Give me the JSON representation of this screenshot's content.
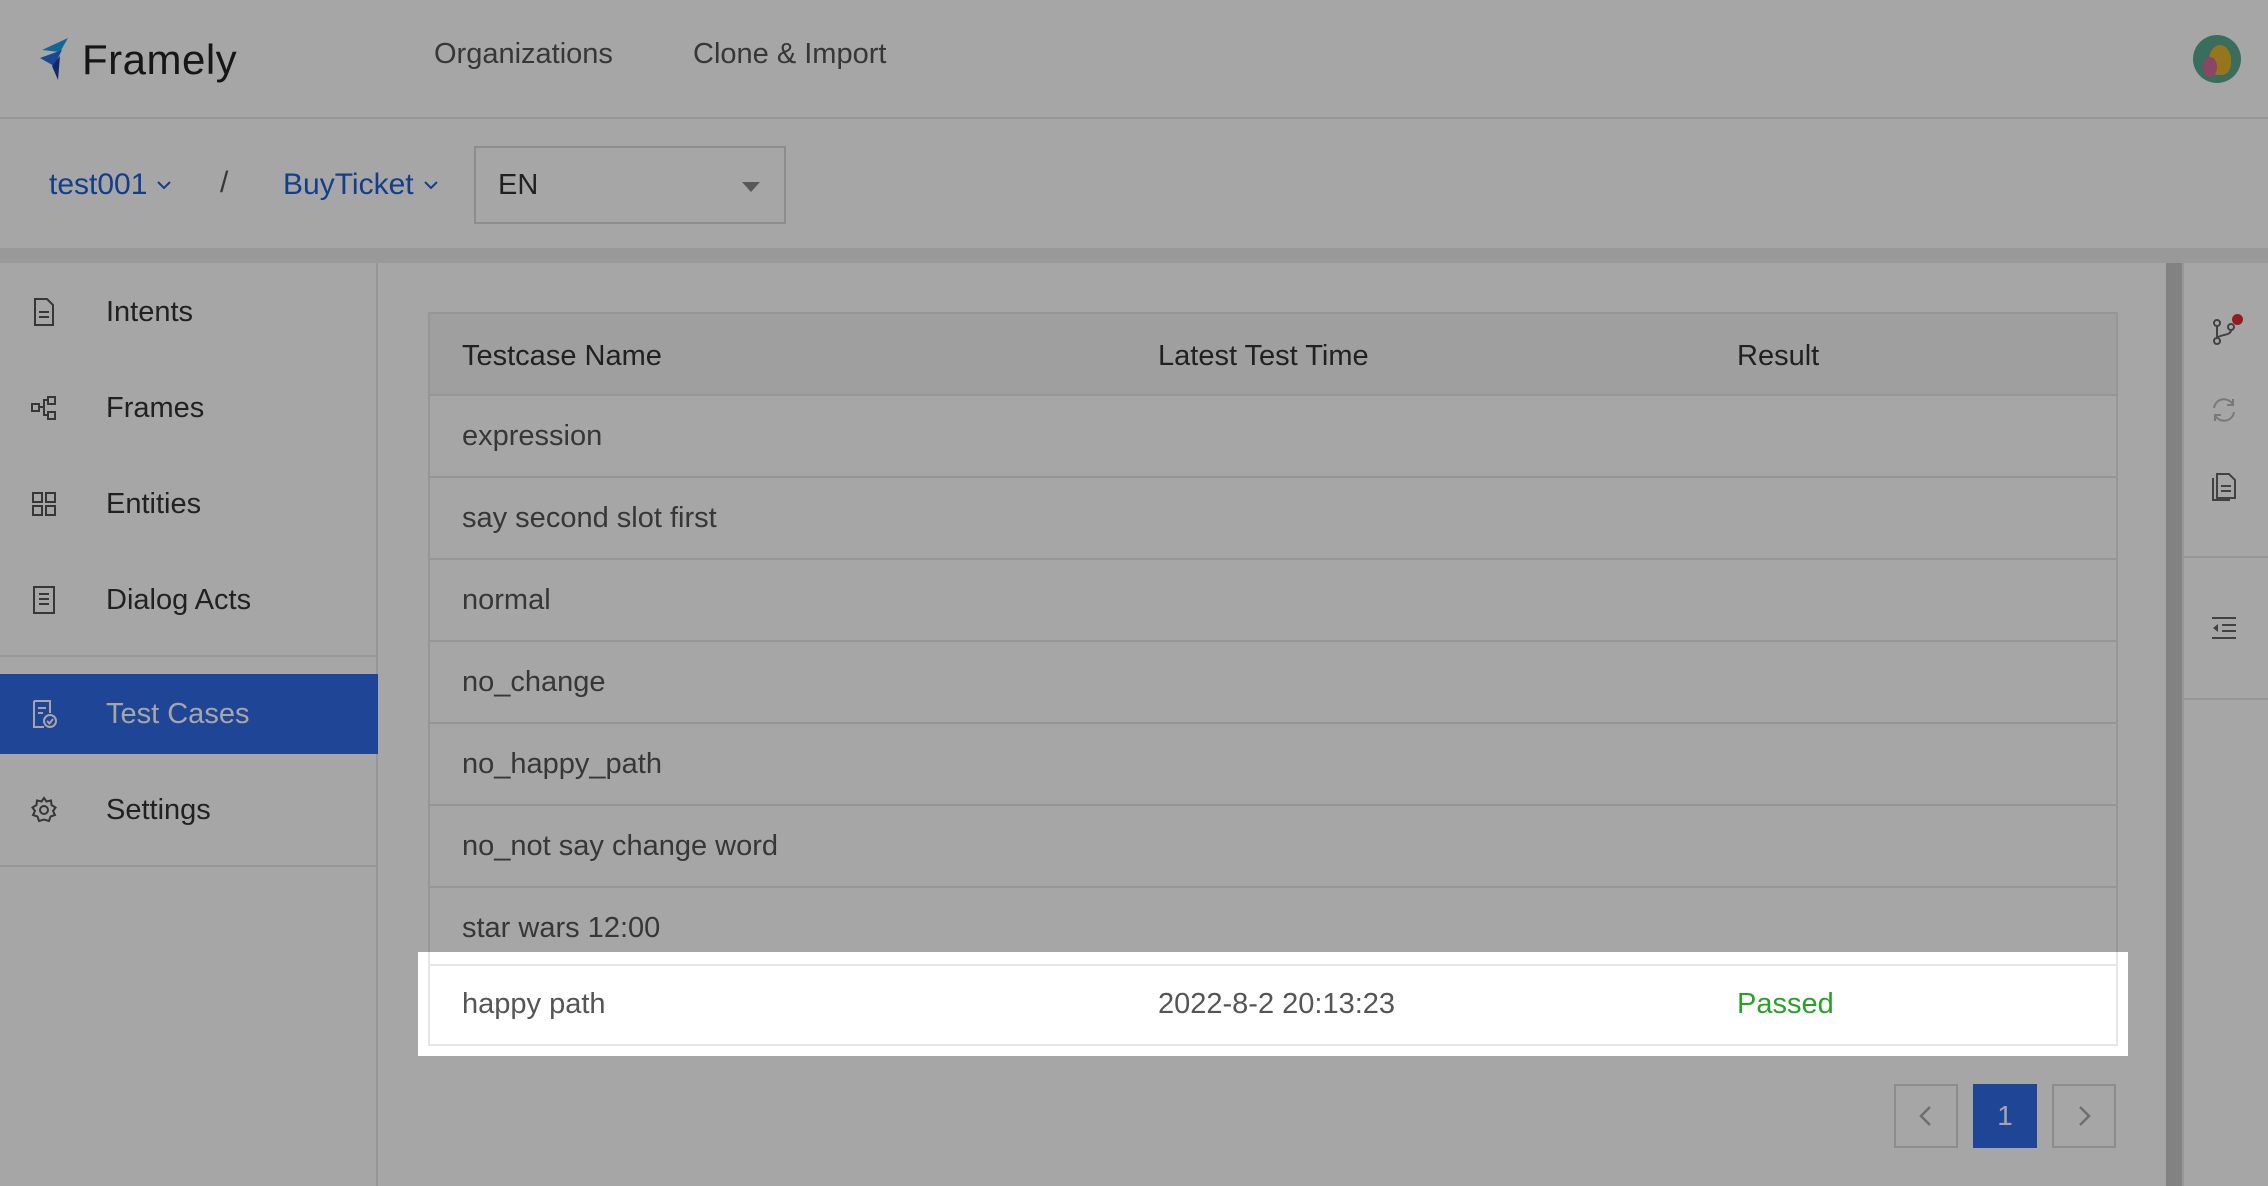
{
  "brand": {
    "name": "Framely"
  },
  "topnav": {
    "items": [
      "Organizations",
      "Clone & Import"
    ]
  },
  "breadcrumb": {
    "org": "test001",
    "separator": "/",
    "project": "BuyTicket"
  },
  "language_select": {
    "value": "EN"
  },
  "sidebar": {
    "items": [
      {
        "label": "Intents",
        "icon": "document-icon"
      },
      {
        "label": "Frames",
        "icon": "flow-icon"
      },
      {
        "label": "Entities",
        "icon": "grid-icon"
      },
      {
        "label": "Dialog Acts",
        "icon": "list-doc-icon"
      },
      {
        "label": "Test Cases",
        "icon": "test-doc-icon",
        "active": true
      },
      {
        "label": "Settings",
        "icon": "gear-icon"
      }
    ]
  },
  "table": {
    "headers": [
      "Testcase Name",
      "Latest Test Time",
      "Result"
    ],
    "rows": [
      {
        "name": "expression",
        "time": "",
        "result": ""
      },
      {
        "name": "say second slot first",
        "time": "",
        "result": ""
      },
      {
        "name": "normal",
        "time": "",
        "result": ""
      },
      {
        "name": "no_change",
        "time": "",
        "result": ""
      },
      {
        "name": "no_happy_path",
        "time": "",
        "result": ""
      },
      {
        "name": "no_not say change word",
        "time": "",
        "result": ""
      },
      {
        "name": "star wars 12:00",
        "time": "",
        "result": ""
      },
      {
        "name": "happy path",
        "time": "2022-8-2 20:13:23",
        "result": "Passed"
      }
    ]
  },
  "pagination": {
    "prev": "<",
    "current": "1",
    "next": ">"
  },
  "colors": {
    "accent": "#2e6ae6",
    "link": "#1f5fd6",
    "passed": "#2aa02a",
    "notification": "#e03030"
  },
  "right_toolbar": {
    "icons": [
      "branch-icon",
      "refresh-icon",
      "copy-doc-icon",
      "indent-icon"
    ]
  }
}
